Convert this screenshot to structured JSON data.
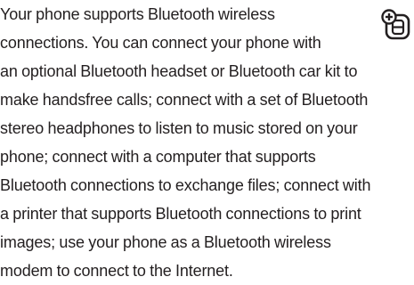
{
  "paragraph": {
    "lines": [
      "Your phone supports Bluetooth wireless",
      "connections. You can connect your phone with",
      "an optional Bluetooth headset or Bluetooth car kit to",
      "make handsfree calls; connect with a set of Bluetooth",
      "stereo headphones to listen to music stored on your",
      "phone; connect with a computer that supports",
      "Bluetooth connections to exchange files; connect with",
      "a printer that supports Bluetooth connections to print",
      "images; use your phone as a Bluetooth wireless",
      "modem to connect to the Internet."
    ]
  },
  "icon": {
    "name": "optional-feature-icon",
    "color": "#231f20"
  }
}
